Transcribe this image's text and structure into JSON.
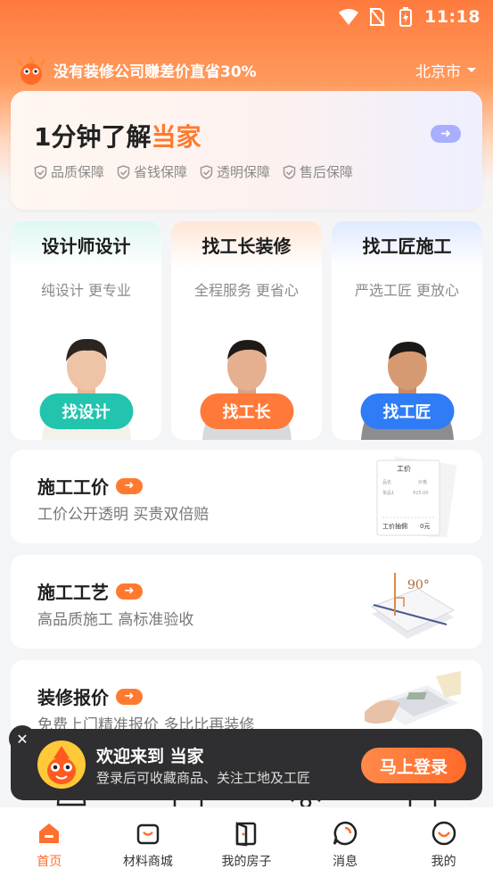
{
  "status": {
    "time": "11:18"
  },
  "promo": {
    "text": "没有装修公司赚差价直省30%",
    "city": "北京市"
  },
  "hero": {
    "title_prefix": "1分钟了解",
    "title_accent": "当家",
    "guarantees": [
      "品质保障",
      "省钱保障",
      "透明保障",
      "售后保障"
    ]
  },
  "services": [
    {
      "title": "设计师设计",
      "subtitle": "纯设计 更专业",
      "button": "找设计",
      "color": "#22c4ad"
    },
    {
      "title": "找工长装修",
      "subtitle": "全程服务 更省心",
      "button": "找工长",
      "color": "#ff7a3a"
    },
    {
      "title": "找工匠施工",
      "subtitle": "严选工匠 更放心",
      "button": "找工匠",
      "color": "#2f7cf6"
    }
  ],
  "info_cards": [
    {
      "title": "施工工价",
      "desc": "工价公开透明  买贵双倍赔"
    },
    {
      "title": "施工工艺",
      "desc": "高品质施工  高标准验收"
    },
    {
      "title": "装修报价",
      "desc": "免费上门精准报价  多比比再装修"
    }
  ],
  "price_sheet": {
    "head": "工价",
    "col1": "品名",
    "col2": "价格",
    "row": "单品1",
    "row_price": "¥25.00",
    "footer": "工价抽佣",
    "footer_val": "0元"
  },
  "angle_label": "90°",
  "login": {
    "title": "欢迎来到 当家",
    "subtitle": "登录后可收藏商品、关注工地及工匠",
    "button": "马上登录"
  },
  "tabs": [
    {
      "label": "首页",
      "icon": "home-icon",
      "active": true
    },
    {
      "label": "材料商城",
      "icon": "shop-bag-icon",
      "active": false
    },
    {
      "label": "我的房子",
      "icon": "door-icon",
      "active": false
    },
    {
      "label": "消息",
      "icon": "message-icon",
      "active": false
    },
    {
      "label": "我的",
      "icon": "profile-icon",
      "active": false
    }
  ],
  "colors": {
    "brand": "#ff7a2e",
    "hero_arrow": "#a9aeff",
    "banner": "#2f2f31"
  }
}
